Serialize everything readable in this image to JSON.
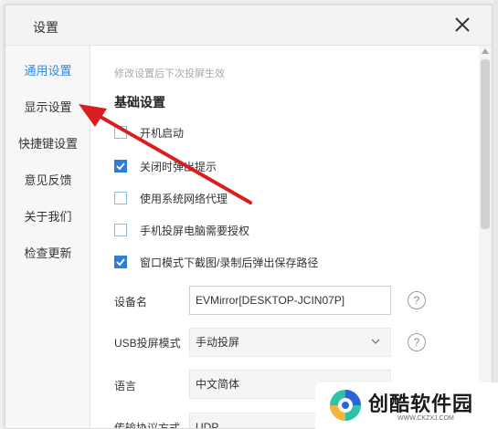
{
  "dialog": {
    "title": "设置",
    "close_icon": "close-icon"
  },
  "sidebar": {
    "items": [
      {
        "label": "通用设置",
        "active": true
      },
      {
        "label": "显示设置",
        "active": false
      },
      {
        "label": "快捷键设置",
        "active": false
      },
      {
        "label": "意见反馈",
        "active": false
      },
      {
        "label": "关于我们",
        "active": false
      },
      {
        "label": "检查更新",
        "active": false
      }
    ]
  },
  "content": {
    "hint": "修改设置后下次投屏生效",
    "section_title": "基础设置",
    "checkboxes": [
      {
        "label": "开机启动",
        "checked": false
      },
      {
        "label": "关闭时弹出提示",
        "checked": true
      },
      {
        "label": "使用系统网络代理",
        "checked": false
      },
      {
        "label": "手机投屏电脑需要授权",
        "checked": false
      },
      {
        "label": "窗口模式下截图/录制后弹出保存路径",
        "checked": true
      }
    ],
    "device_name": {
      "label": "设备名",
      "value": "EVMirror[DESKTOP-JCIN07P]"
    },
    "usb_mode": {
      "label": "USB投屏模式",
      "value": "手动投屏"
    },
    "language": {
      "label": "语言",
      "value": "中文简体"
    },
    "protocol": {
      "label": "传输协议方式",
      "value": "UDP"
    },
    "help_symbol": "?"
  },
  "watermark": {
    "name": "创酷软件园",
    "url": "WWW.CKZXJ.COM"
  },
  "colors": {
    "accent": "#2e8be6",
    "checkbox_checked": "#2e7fd8",
    "annotation_arrow": "#d81e1e"
  }
}
